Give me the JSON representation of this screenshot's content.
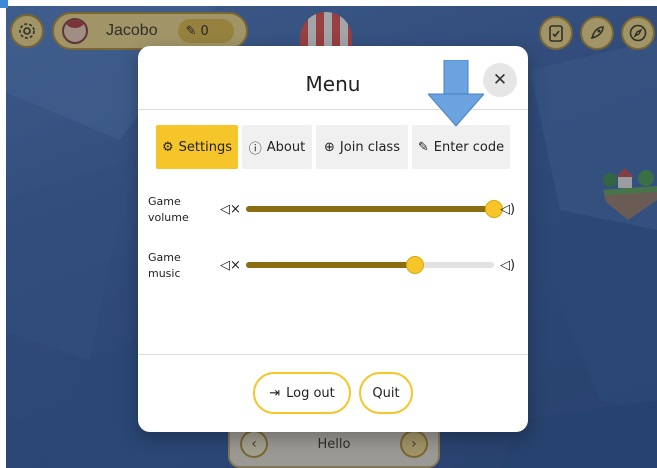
{
  "header": {
    "username": "Jacobo",
    "points": "0",
    "settings_icon": "gear-icon",
    "right_buttons": [
      {
        "icon": "clipboard-check-icon"
      },
      {
        "icon": "rocket-icon"
      },
      {
        "icon": "compass-icon"
      }
    ]
  },
  "bottom_card": {
    "text": "Hello",
    "prev_symbol": "‹",
    "next_symbol": "›"
  },
  "menu": {
    "title": "Menu",
    "close_symbol": "✕",
    "tabs": [
      {
        "label": "Settings",
        "icon": "gear-icon",
        "symbol": "⚙",
        "active": true
      },
      {
        "label": "About",
        "icon": "info-icon",
        "symbol": "ⓘ",
        "active": false
      },
      {
        "label": "Join class",
        "icon": "plus-circle-icon",
        "symbol": "⊕",
        "active": false
      },
      {
        "label": "Enter code",
        "icon": "pencil-icon",
        "symbol": "✎",
        "active": false
      }
    ],
    "settings": {
      "sliders": [
        {
          "label": "Game volume",
          "value": 1.0
        },
        {
          "label": "Game music",
          "value": 0.68
        }
      ],
      "mute_symbol": "◁×",
      "loud_symbol": "◁)"
    },
    "footer": {
      "logout_label": "Log out",
      "logout_icon": "logout-icon",
      "logout_symbol": "⇥",
      "quit_label": "Quit"
    }
  },
  "colors": {
    "accent": "#f5c529",
    "slider_fill": "#8a6d10",
    "background": "#3c5d92",
    "arrow": "#6aa3e0"
  }
}
